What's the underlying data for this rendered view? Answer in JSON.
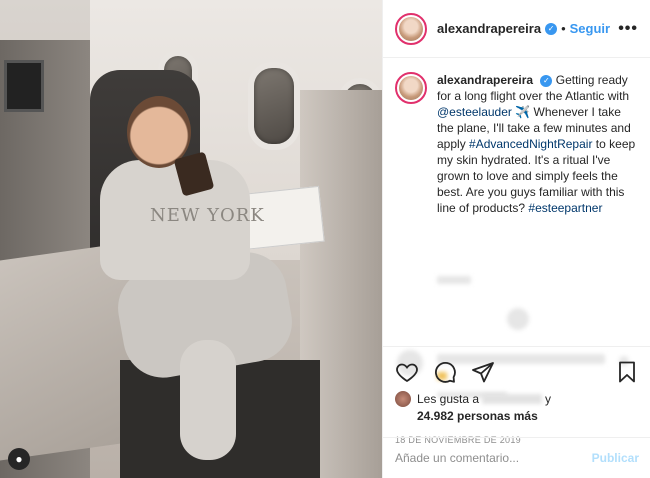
{
  "post": {
    "image_alt": "Woman in grey sweatsuit seated in airplane business-class seat holding skincare bottle",
    "hoodie_print": "NEW YORK"
  },
  "header": {
    "username": "alexandrapereira",
    "verified_icon": "verified-badge-icon",
    "separator": "•",
    "follow_label": "Seguir",
    "more_label": "•••"
  },
  "caption": {
    "username": "alexandrapereira",
    "text_1": "Getting ready for a long flight over the Atlantic with ",
    "mention": "@esteelauder",
    "text_2": " ✈️ Whenever I take the plane, I'll take a few minutes and apply ",
    "hashtag_1": "#AdvancedNightRepair",
    "text_3": " to keep my skin hydrated. It's a ritual I've grown to love and simply feels the best. Are you guys familiar with this line of products? ",
    "hashtag_2": "#esteepartner"
  },
  "actions": {
    "like_icon": "heart-icon",
    "comment_icon": "comment-icon",
    "share_icon": "share-icon",
    "save_icon": "bookmark-icon"
  },
  "likes": {
    "prefix": "Les gusta a",
    "connector": "y",
    "count_text": "24.982 personas más"
  },
  "date": "18 DE NOVIEMBRE DE 2019",
  "comment_box": {
    "placeholder": "Añade un comentario...",
    "publish_label": "Publicar"
  },
  "colors": {
    "accent_blue": "#3897f0",
    "tag_color": "#00376b",
    "publish_disabled": "#b2dffc",
    "ring": "#e1306c"
  }
}
